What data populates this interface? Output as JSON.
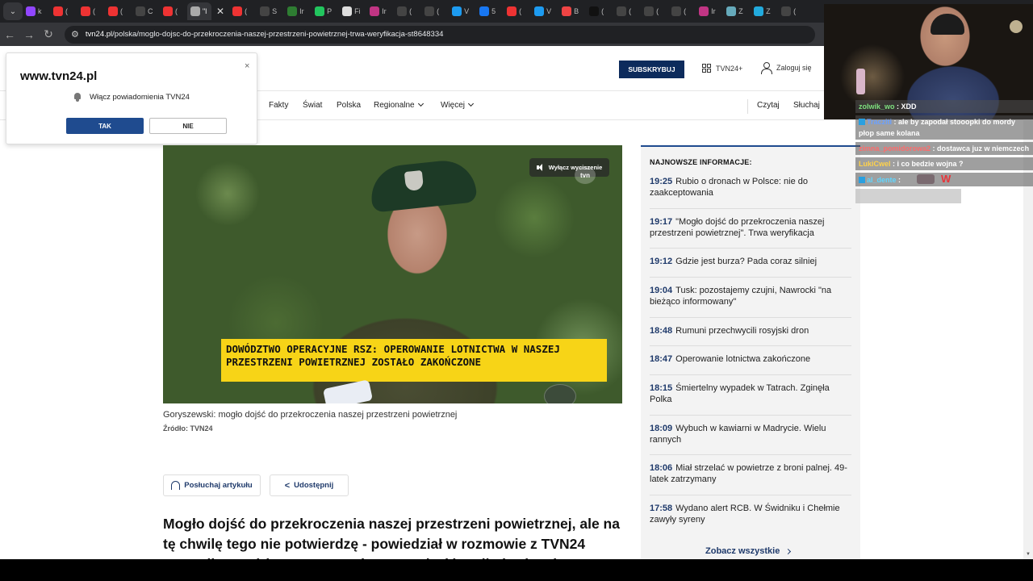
{
  "browser": {
    "tab_labels": [
      "k",
      "(",
      "(",
      "(",
      "C",
      "(",
      "\"l",
      "(",
      "S",
      "Ir",
      "P",
      "Fi",
      "Ir",
      "(",
      "(",
      "V",
      "5",
      "(",
      "V",
      "B",
      "(",
      "(",
      "(",
      "(",
      "Ir",
      "Z",
      "Z",
      "("
    ],
    "active_tab_label": "\"l",
    "url_prefix": "tvn24.pl",
    "url_path": "/polska/moglo-dojsc-do-przekroczenia-naszej-przestrzeni-powietrznej-trwa-weryfikacja-st8648334"
  },
  "header": {
    "subscribe": "SUBSKRYBUJ",
    "tvn_plus": "TVN24+",
    "login": "Zaloguj się"
  },
  "nav": {
    "items": [
      "Fakty",
      "Świat",
      "Polska",
      "Regionalne",
      "Więcej"
    ],
    "right_items": [
      "Czytaj",
      "Słuchaj"
    ]
  },
  "popup": {
    "title": "www.tvn24.pl",
    "close": "×",
    "message": "Włącz powiadomienia TVN24",
    "yes": "TAK",
    "no": "NIE"
  },
  "video": {
    "mute_label": "Wyłącz wyciszenie",
    "logo": "tvn",
    "banner_line1": "DOWÓDZTWO OPERACYJNE RSZ: OPEROWANIE LOTNICTWA W NASZEJ",
    "banner_line2": "PRZESTRZENI POWIETRZNEJ ZOSTAŁO ZAKOŃCZONE"
  },
  "article": {
    "caption": "Goryszewski: mogło dojść do przekroczenia naszej przestrzeni powietrznej",
    "source": "Źródło: TVN24",
    "listen": "Posłuchaj artykułu",
    "share": "Udostępnij",
    "lead": "Mogło dojść do przekroczenia naszej przestrzeni powietrznej, ale na tę chwilę tego nie potwierdzę - powiedział w rozmowie z TVN24 rzecznik Dowództwa Operacyjnego Rodzajów Sił Zbrojnych"
  },
  "sidebar": {
    "title": "NAJNOWSZE INFORMACJE:",
    "items": [
      {
        "time": "19:25",
        "text": "Rubio o dronach w Polsce: nie do zaakceptowania"
      },
      {
        "time": "19:17",
        "text": "\"Mogło dojść do przekroczenia naszej przestrzeni powietrznej\". Trwa weryfikacja"
      },
      {
        "time": "19:12",
        "text": "Gdzie jest burza? Pada coraz silniej"
      },
      {
        "time": "19:04",
        "text": "Tusk: pozostajemy czujni, Nawrocki \"na bieżąco informowany\""
      },
      {
        "time": "18:48",
        "text": "Rumuni przechwycili rosyjski dron"
      },
      {
        "time": "18:47",
        "text": "Operowanie lotnictwa zakończone"
      },
      {
        "time": "18:15",
        "text": "Śmiertelny wypadek w Tatrach. Zginęła Polka"
      },
      {
        "time": "18:09",
        "text": "Wybuch w kawiarni w Madrycie. Wielu rannych"
      },
      {
        "time": "18:06",
        "text": "Miał strzelać w powietrze z broni palnej. 49-latek zatrzymany"
      },
      {
        "time": "17:58",
        "text": "Wydano alert RCB. W Świdniku i Chełmie zawyły syreny"
      }
    ],
    "see_all": "Zobacz wszystkie"
  },
  "chat": {
    "messages": [
      {
        "user": "zolwik_wo",
        "text": ": XDD",
        "color": "#7ee07e"
      },
      {
        "user": "Tracziti",
        "text": ": ale by zapodał stooopki do mordy płop same kolana",
        "color": "#6aa0ff"
      },
      {
        "user": "zimna_pomidorowa2",
        "text": ": dostawca juz w niemczech",
        "color": "#ff6b6b"
      },
      {
        "user": "LukiCwel",
        "text": ": i co bedzie wojna ?",
        "color": "#ffd24a"
      },
      {
        "user": "al_dente",
        "text": ":",
        "color": "#5fd6ff"
      }
    ],
    "emote_text": "W"
  },
  "colors": {
    "brand_navy": "#0d2b5c",
    "button_blue": "#1f4b8f",
    "banner_yellow": "#f7d417",
    "link_navy": "#1f3a6b"
  }
}
